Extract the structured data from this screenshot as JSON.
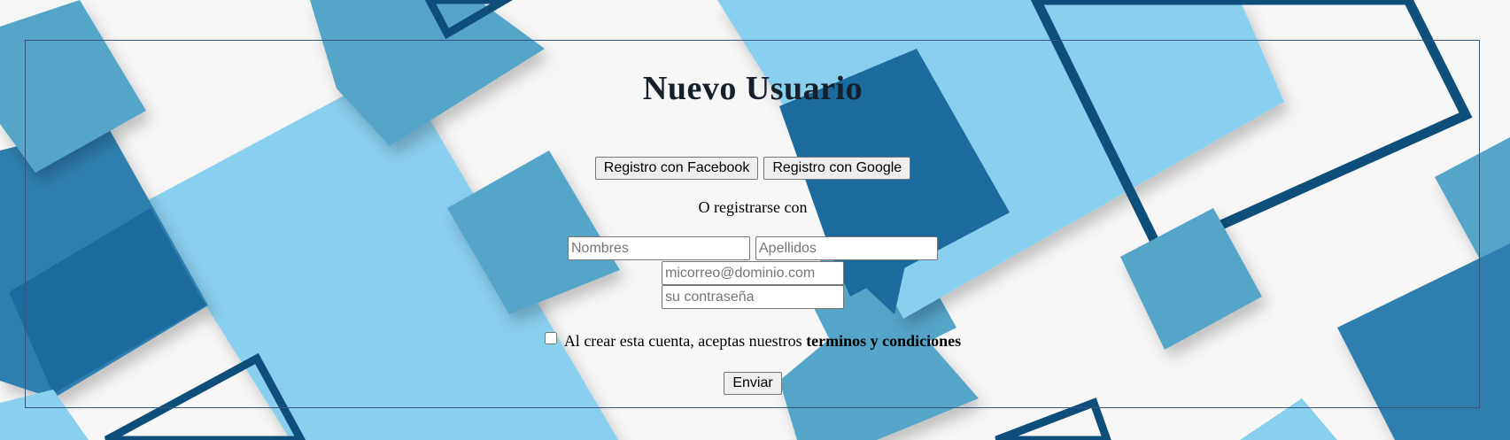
{
  "form": {
    "title": "Nuevo Usuario",
    "facebook_button": "Registro con Facebook",
    "google_button": "Registro con Google",
    "or_text": "O registrarse con",
    "first_name": {
      "value": "",
      "placeholder": "Nombres"
    },
    "last_name": {
      "value": "",
      "placeholder": "Apellidos"
    },
    "email": {
      "value": "",
      "placeholder": "micorreo@dominio.com"
    },
    "password": {
      "value": "",
      "placeholder": "su contraseña"
    },
    "terms_text": "Al crear esta cuenta, aceptas nuestros",
    "terms_link": "terminos y condiciones",
    "terms_checked": false,
    "submit_button": "Enviar"
  },
  "colors": {
    "light_blue": "#89cfee",
    "mid_blue": "#55a5c9",
    "dark_blue": "#1b6b9e",
    "navy_stroke": "#0d4f7a",
    "background": "#f7f7f7",
    "frame_border": "#35557a"
  }
}
